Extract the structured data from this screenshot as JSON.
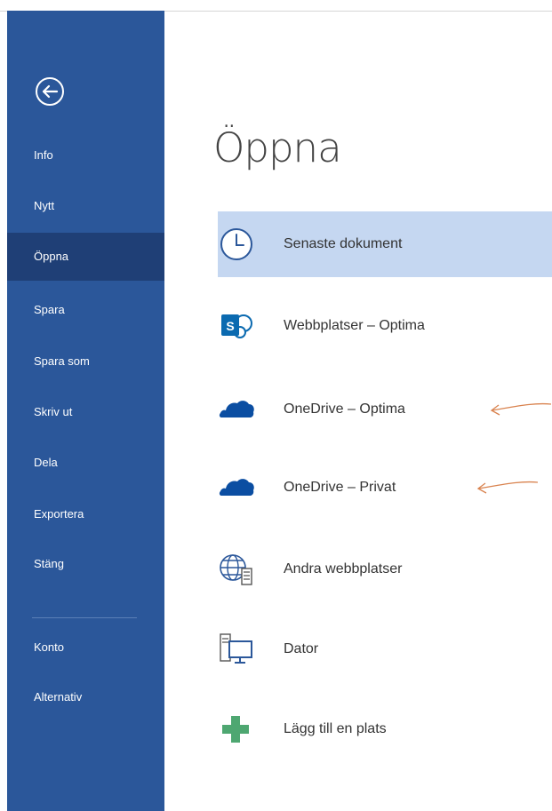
{
  "page": {
    "title": "Öppna"
  },
  "sidebar": {
    "items": [
      {
        "label": "Info"
      },
      {
        "label": "Nytt"
      },
      {
        "label": "Öppna"
      },
      {
        "label": "Spara"
      },
      {
        "label": "Spara som"
      },
      {
        "label": "Skriv ut"
      },
      {
        "label": "Dela"
      },
      {
        "label": "Exportera"
      },
      {
        "label": "Stäng"
      },
      {
        "label": "Konto"
      },
      {
        "label": "Alternativ"
      }
    ],
    "active_item": "Öppna"
  },
  "locations": [
    {
      "label": "Senaste dokument",
      "icon": "clock-icon"
    },
    {
      "label": "Webbplatser – Optima",
      "icon": "sharepoint-icon"
    },
    {
      "label": "OneDrive – Optima",
      "icon": "onedrive-icon"
    },
    {
      "label": "OneDrive – Privat",
      "icon": "onedrive-icon"
    },
    {
      "label": "Andra webbplatser",
      "icon": "globe-icon"
    },
    {
      "label": "Dator",
      "icon": "computer-icon"
    },
    {
      "label": "Lägg till en plats",
      "icon": "plus-icon"
    }
  ],
  "colors": {
    "sidebar": "#2b579a",
    "sidebar_active": "#1f3f76",
    "selected_row": "#c5d7f1",
    "annotation_arrow": "#d9834f",
    "plus_icon": "#4ea771"
  }
}
